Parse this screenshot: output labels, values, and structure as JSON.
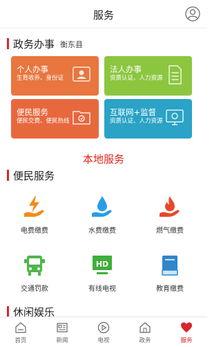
{
  "header": {
    "title": "服务"
  },
  "gov_section": {
    "title": "政务办事",
    "location": "衡东县"
  },
  "gov_cards": [
    {
      "title": "个人办事",
      "subtitle": "生育收养、身份证",
      "color": "#e8763e"
    },
    {
      "title": "法人办事",
      "subtitle": "资质认证、人力资源",
      "color": "#8cc63f"
    },
    {
      "title": "便民服务",
      "subtitle": "便民交费、便民热线",
      "color": "#e8683e"
    },
    {
      "title": "互联网+监督",
      "subtitle": "资质认证、人力资源",
      "color": "#2aa3c6"
    }
  ],
  "local_services_title": "本地服务",
  "convenience_section": {
    "title": "便民服务"
  },
  "services": [
    {
      "label": "电费缴费",
      "icon": "electricity-icon",
      "color": "#f08c1a"
    },
    {
      "label": "水费缴费",
      "icon": "water-drop-icon",
      "color": "#2a9de6"
    },
    {
      "label": "燃气缴费",
      "icon": "gas-flame-icon",
      "color": "#e9472b"
    },
    {
      "label": "交通罚款",
      "icon": "bus-icon",
      "color": "#4fb64a"
    },
    {
      "label": "有线电视",
      "icon": "hd-tv-icon",
      "color": "#3fae3a"
    },
    {
      "label": "教育缴费",
      "icon": "book-icon",
      "color": "#2f86c9"
    }
  ],
  "leisure_section": {
    "title": "休闲娱乐"
  },
  "tabbar": [
    {
      "label": "首页",
      "icon": "home-icon"
    },
    {
      "label": "新闻",
      "icon": "news-icon"
    },
    {
      "label": "电视",
      "icon": "play-icon"
    },
    {
      "label": "政务",
      "icon": "gov-building-icon"
    },
    {
      "label": "服务",
      "icon": "heart-icon",
      "active": true
    }
  ]
}
